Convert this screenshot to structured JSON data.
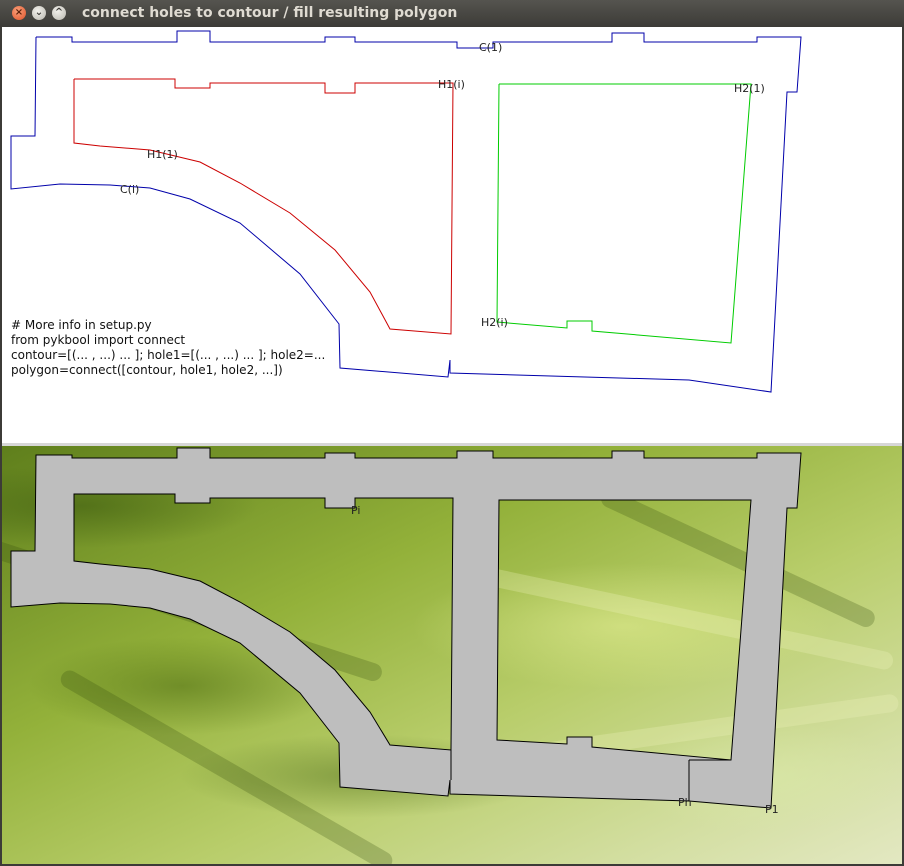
{
  "window": {
    "title": "connect holes to contour / fill resulting polygon",
    "buttons": {
      "close": "×",
      "minimize": "⌄",
      "maximize": "^"
    }
  },
  "top_panel": {
    "labels": {
      "contour_top": "C(1)",
      "contour_low": "C(i)",
      "hole1_right": "H1(i)",
      "hole1_mid": "H1(1)",
      "hole2_top": "H2(1)",
      "hole2_bottom": "H2(i)"
    },
    "code_lines": [
      "# More info in setup.py",
      "from pykbool import connect",
      "contour=[(... , ...) ... ]; hole1=[(... , ...) ... ]; hole2=...",
      "polygon=connect([contour, hole1, hole2, ...])"
    ],
    "colors": {
      "contour": "#0000aa",
      "hole1": "#cc0000",
      "hole2": "#00cc00"
    }
  },
  "bottom_panel": {
    "labels": {
      "pi": "Pi",
      "ph": "Ph",
      "p1": "P1"
    },
    "colors": {
      "fill": "#bebebe",
      "outline": "#000000"
    }
  }
}
